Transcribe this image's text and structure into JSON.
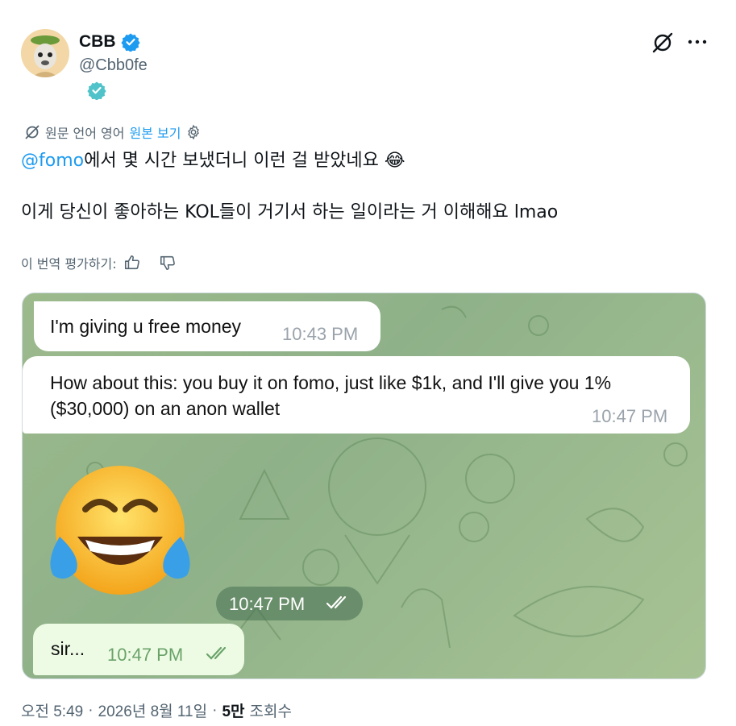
{
  "author": {
    "name": "CBB",
    "handle": "@Cbb0fe"
  },
  "translation": {
    "info": "원문 언어 영어",
    "show_original": "원본 보기"
  },
  "tweet": {
    "mention": "@fomo",
    "line1_rest": "에서 몇 시간 보냈더니 이런 걸 받았네요 😂",
    "line2": "이게 당신이 좋아하는 KOL들이 거기서 하는 일이라는 거 이해해요 lmao"
  },
  "rate_label": "이 번역 평가하기:",
  "chat": {
    "messages": [
      {
        "text": "I'm giving u free money",
        "time": "10:43 PM"
      },
      {
        "text": "How about this: you buy it on fomo, just like $1k, and I'll give you 1% ($30,000) on an anon wallet",
        "time": "10:47 PM"
      }
    ],
    "emoji_time": "10:47 PM",
    "reply": {
      "text": "sir...",
      "time": "10:47 PM"
    }
  },
  "meta": {
    "time": "오전 5:49",
    "date": "2026년 8월 11일",
    "views_count": "5만",
    "views_label": "조회수"
  },
  "colors": {
    "link": "#1d9bf0",
    "verified": "#1d9bf0",
    "chat_bg": "#9cba8c",
    "outgoing_bubble": "#eefbe4"
  },
  "icons": [
    "verified-badge-icon",
    "affiliate-badge-icon",
    "grok-icon",
    "more-icon",
    "translate-icon",
    "settings-gear-icon",
    "thumbs-up-icon",
    "thumbs-down-icon",
    "double-check-icon"
  ]
}
